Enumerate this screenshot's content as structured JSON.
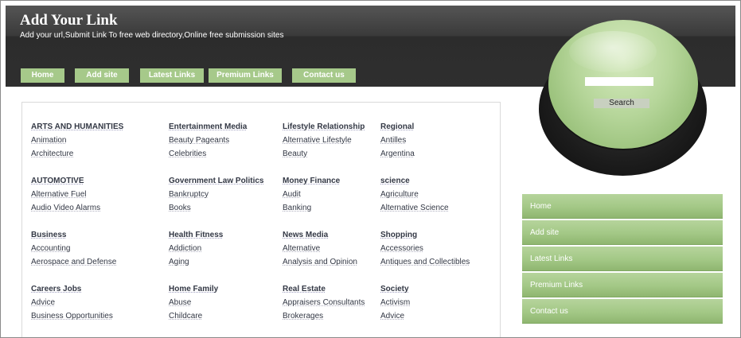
{
  "header": {
    "title": "Add Your Link",
    "tagline": "Add your url,Submit Link To free web directory,Online free submission sites"
  },
  "topnav": [
    "Home",
    "Add site",
    "Latest Links",
    "Premium Links",
    "Contact us"
  ],
  "search": {
    "button": "Search",
    "placeholder": ""
  },
  "sidebar": [
    "Home",
    "Add site",
    "Latest Links",
    "Premium Links",
    "Contact us"
  ],
  "directory": {
    "rows": [
      [
        {
          "heading": "ARTS AND HUMANITIES",
          "links": [
            "Animation",
            "Architecture"
          ]
        },
        {
          "heading": "Entertainment Media",
          "links": [
            "Beauty Pageants",
            "Celebrities"
          ]
        },
        {
          "heading": "Lifestyle Relationship",
          "links": [
            "Alternative Lifestyle",
            "Beauty"
          ]
        },
        {
          "heading": "Regional",
          "links": [
            "Antilles",
            "Argentina"
          ]
        }
      ],
      [
        {
          "heading": "AUTOMOTIVE",
          "links": [
            "Alternative Fuel",
            "Audio Video Alarms"
          ]
        },
        {
          "heading": "Government Law Politics",
          "links": [
            "Bankruptcy",
            "Books"
          ]
        },
        {
          "heading": "Money Finance",
          "links": [
            "Audit",
            "Banking"
          ]
        },
        {
          "heading": "science",
          "links": [
            "Agriculture",
            "Alternative Science"
          ]
        }
      ],
      [
        {
          "heading": "Business",
          "links": [
            "Accounting",
            "Aerospace and Defense"
          ]
        },
        {
          "heading": "Health Fitness",
          "links": [
            "Addiction",
            "Aging"
          ]
        },
        {
          "heading": "News Media",
          "links": [
            "Alternative",
            "Analysis and Opinion"
          ]
        },
        {
          "heading": "Shopping",
          "links": [
            "Accessories",
            "Antiques and Collectibles"
          ]
        }
      ],
      [
        {
          "heading": "Careers Jobs",
          "links": [
            "Advice",
            "Business Opportunities"
          ]
        },
        {
          "heading": "Home Family",
          "links": [
            "Abuse",
            "Childcare"
          ]
        },
        {
          "heading": "Real Estate",
          "links": [
            "Appraisers Consultants",
            "Brokerages"
          ]
        },
        {
          "heading": "Society",
          "links": [
            "Activism",
            "Advice"
          ]
        }
      ]
    ]
  }
}
